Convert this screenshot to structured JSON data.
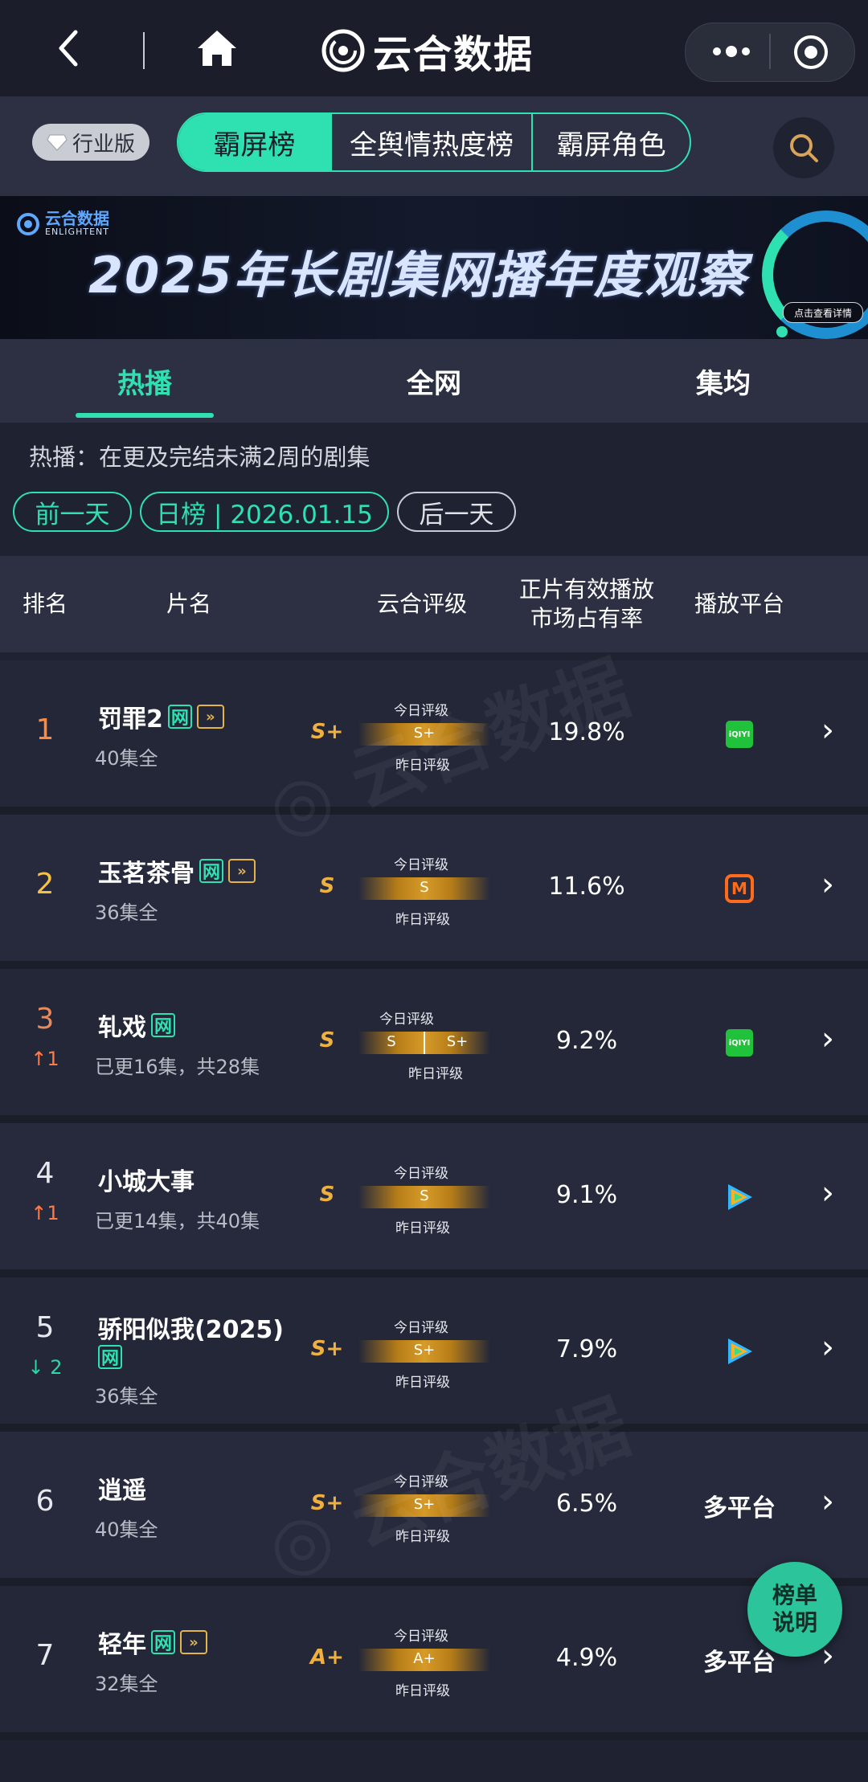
{
  "nav": {
    "title": "云合数据"
  },
  "header": {
    "edition_label": "行业版",
    "tabs": [
      "霸屏榜",
      "全舆情热度榜",
      "霸屏角色"
    ]
  },
  "banner": {
    "brand": "云合数据",
    "brand_sub": "ENLIGHTENT",
    "title": "2025年长剧集网播年度观察",
    "detail_button": "点击查看详情"
  },
  "subtabs": [
    "热播",
    "全网",
    "集均"
  ],
  "info": {
    "description": "热播：在更及完结未满2周的剧集",
    "prev_day": "前一天",
    "date": "日榜 | 2026.01.15",
    "next_day": "后一天"
  },
  "table": {
    "headers": {
      "rank": "排名",
      "title": "片名",
      "rating": "云合评级",
      "share_line1": "正片有效播放",
      "share_line2": "市场占有率",
      "platform": "播放平台"
    },
    "today_label": "今日评级",
    "yesterday_label": "昨日评级",
    "rows": [
      {
        "rank": "1",
        "trend": "",
        "title": "罚罪2",
        "episodes": "40集全",
        "grade": "S+",
        "today": "S+",
        "yesterday": "",
        "share": "19.8%",
        "platform": "iqiyi",
        "platform_text": "iQIYI"
      },
      {
        "rank": "2",
        "trend": "",
        "title": "玉茗茶骨",
        "episodes": "36集全",
        "grade": "S",
        "today": "S",
        "yesterday": "",
        "share": "11.6%",
        "platform": "mango",
        "platform_text": "M"
      },
      {
        "rank": "3",
        "trend": "↑1",
        "title": "轧戏",
        "episodes": "已更16集，共28集",
        "grade": "S",
        "today": "S",
        "yesterday": "S+",
        "share": "9.2%",
        "platform": "iqiyi",
        "platform_text": "iQIYI"
      },
      {
        "rank": "4",
        "trend": "↑1",
        "title": "小城大事",
        "episodes": "已更14集，共40集",
        "grade": "S",
        "today": "S",
        "yesterday": "",
        "share": "9.1%",
        "platform": "tencent",
        "platform_text": ""
      },
      {
        "rank": "5",
        "trend": "↓ 2",
        "title": "骄阳似我(2025)",
        "episodes": "36集全",
        "grade": "S+",
        "today": "S+",
        "yesterday": "",
        "share": "7.9%",
        "platform": "tencent",
        "platform_text": ""
      },
      {
        "rank": "6",
        "trend": "",
        "title": "逍遥",
        "episodes": "40集全",
        "grade": "S+",
        "today": "S+",
        "yesterday": "",
        "share": "6.5%",
        "platform": "multi",
        "platform_text": "多平台"
      },
      {
        "rank": "7",
        "trend": "",
        "title": "轻年",
        "episodes": "32集全",
        "grade": "A+",
        "today": "A+",
        "yesterday": "",
        "share": "4.9%",
        "platform": "multi",
        "platform_text": "多平台"
      }
    ]
  },
  "help_button": [
    "榜单",
    "说明"
  ],
  "colors": {
    "accent": "#2fe0b0",
    "grade": "#f0b040",
    "up": "#ff7a45",
    "down": "#2fd6a8"
  }
}
